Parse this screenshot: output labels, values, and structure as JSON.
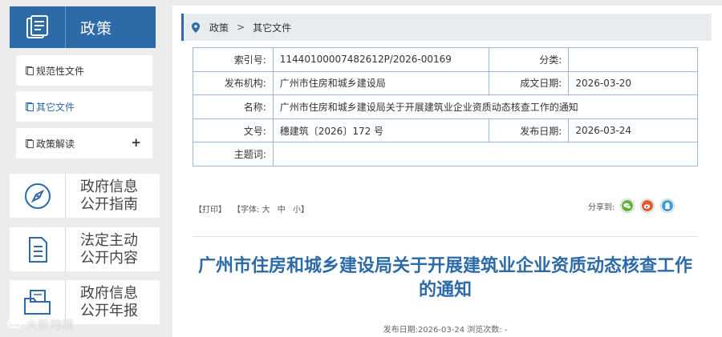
{
  "sidebar": {
    "header_title": "政策",
    "menu": [
      {
        "label": "规范性文件",
        "active": false
      },
      {
        "label": "其它文件",
        "active": true
      },
      {
        "label": "政策解读",
        "active": false,
        "expand": "+"
      }
    ],
    "cards": [
      {
        "line1": "政府信息",
        "line2": "公开指南",
        "icon": "compass-icon"
      },
      {
        "line1": "法定主动",
        "line2": "公开内容",
        "icon": "document-icon"
      },
      {
        "line1": "政府信息",
        "line2": "公开年报",
        "icon": "folder-icon"
      }
    ]
  },
  "breadcrumb": {
    "items": [
      "政策",
      "其它文件"
    ],
    "separator": ">"
  },
  "meta": {
    "index_label": "索引号:",
    "index_value": "11440100007482612P/2026-00169",
    "category_label": "分类:",
    "category_value": "",
    "publisher_label": "发布机构:",
    "publisher_value": "广州市住房和城乡建设局",
    "created_label": "成文日期:",
    "created_value": "2026-03-20",
    "name_label": "名称:",
    "name_value": "广州市住房和城乡建设局关于开展建筑业企业资质动态核查工作的通知",
    "docno_label": "文号:",
    "docno_value": "穗建筑〔2026〕172 号",
    "pubdate_label": "发布日期:",
    "pubdate_value": "2026-03-24",
    "keywords_label": "主题词:",
    "keywords_value": ""
  },
  "tools": {
    "print": "【打印】",
    "font_prefix": "【字体:",
    "font_large": "大",
    "font_medium": "中",
    "font_small": "小",
    "font_suffix": "】"
  },
  "share": {
    "label": "分享到:",
    "channels": [
      "wechat-icon",
      "weibo-icon",
      "qq-icon"
    ]
  },
  "article": {
    "title": "广州市住房和城乡建设局关于开展建筑业企业资质动态核查工作的通知",
    "pubinfo": "发布日期:2026-03-24  浏览次数: -"
  },
  "watermark": {
    "text": "大数跨境"
  },
  "colors": {
    "accent": "#2d6aa8",
    "border": "#9bb8d6",
    "wechat": "#5cb531",
    "weibo": "#e8582d",
    "qq": "#3a9ee0"
  }
}
